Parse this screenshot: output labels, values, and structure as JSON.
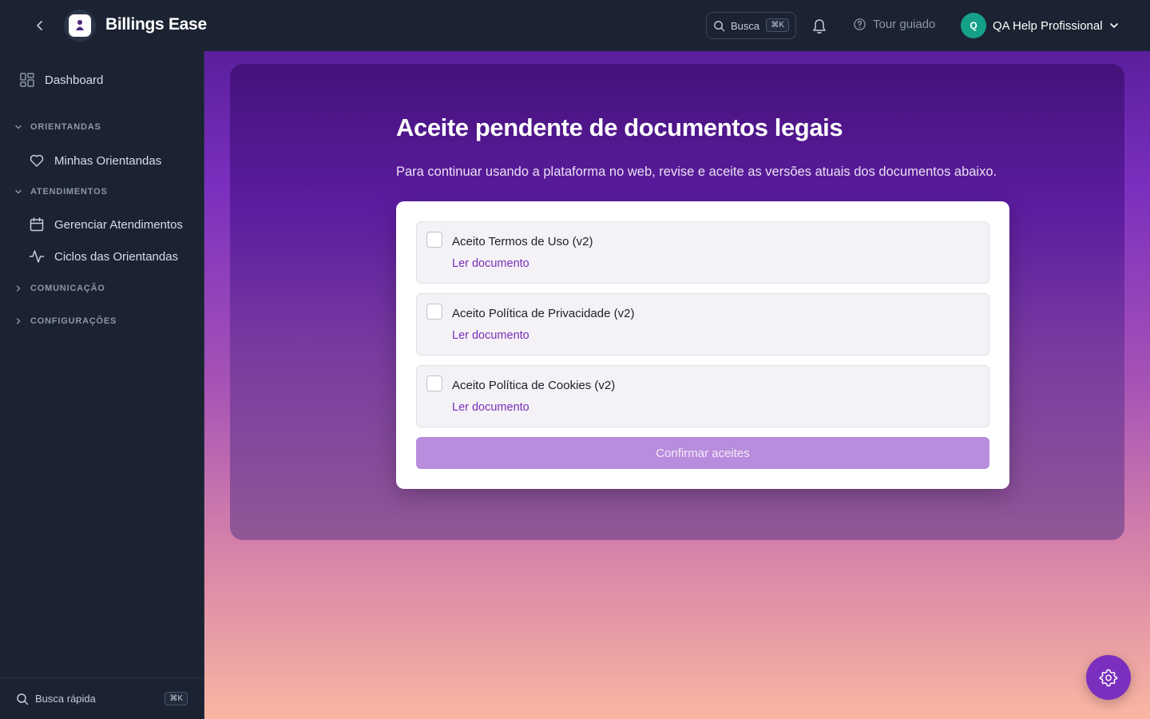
{
  "header": {
    "brand": "Billings Ease",
    "search_label": "Busca",
    "search_shortcut": "⌘K",
    "tour_label": "Tour guiado",
    "user_initial": "Q",
    "user_name": "QA Help Profissional"
  },
  "sidebar": {
    "dashboard": "Dashboard",
    "sections": [
      {
        "label": "ORIENTANDAS",
        "expanded": true,
        "items": [
          "Minhas Orientandas"
        ]
      },
      {
        "label": "ATENDIMENTOS",
        "expanded": true,
        "items": [
          "Gerenciar Atendimentos",
          "Ciclos das Orientandas"
        ]
      },
      {
        "label": "COMUNICAÇÃO",
        "expanded": false,
        "items": []
      },
      {
        "label": "CONFIGURAÇÕES",
        "expanded": false,
        "items": []
      }
    ],
    "quick_search": "Busca rápida",
    "quick_search_shortcut": "⌘K"
  },
  "main": {
    "title": "Aceite pendente de documentos legais",
    "subtitle": "Para continuar usando a plataforma no web, revise e aceite as versões atuais dos documentos abaixo.",
    "documents": [
      {
        "label": "Aceito Termos de Uso (v2)",
        "link": "Ler documento",
        "checked": false
      },
      {
        "label": "Aceito Política de Privacidade (v2)",
        "link": "Ler documento",
        "checked": false
      },
      {
        "label": "Aceito Política de Cookies (v2)",
        "link": "Ler documento",
        "checked": false
      }
    ],
    "confirm_label": "Confirmar aceites"
  },
  "colors": {
    "sidebar_bg": "#1b2332",
    "accent": "#7a2fbe",
    "link": "#7b2fb8",
    "avatar": "#15a08a",
    "confirm_disabled": "#b98ddd"
  }
}
